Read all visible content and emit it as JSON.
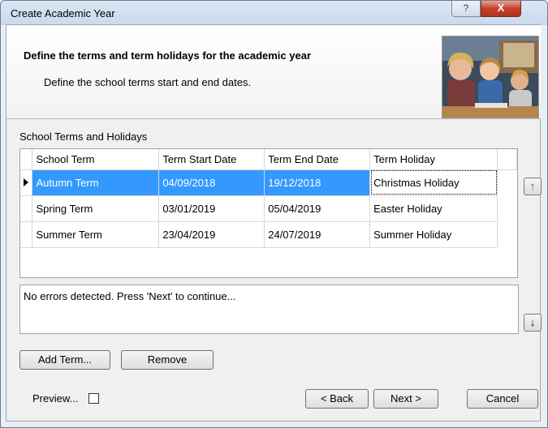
{
  "window": {
    "title": "Create Academic Year",
    "help_symbol": "?",
    "close_symbol": "X"
  },
  "header": {
    "title": "Define the terms and term holidays for the academic year",
    "subtitle": "Define the school terms start and end dates."
  },
  "section": {
    "label": "School Terms and Holidays"
  },
  "grid": {
    "columns": [
      "School Term",
      "Term Start Date",
      "Term End Date",
      "Term Holiday"
    ],
    "rows": [
      {
        "term": "Autumn Term",
        "start": "04/09/2018",
        "end": "19/12/2018",
        "holiday": "Christmas Holiday"
      },
      {
        "term": "Spring Term",
        "start": "03/01/2019",
        "end": "05/04/2019",
        "holiday": "Easter Holiday"
      },
      {
        "term": "Summer Term",
        "start": "23/04/2019",
        "end": "24/07/2019",
        "holiday": "Summer Holiday"
      }
    ]
  },
  "message": "No errors detected. Press 'Next' to continue...",
  "side_buttons": {
    "up_symbol": "↑",
    "down_symbol": "↓"
  },
  "buttons": {
    "add_term": "Add Term...",
    "remove": "Remove",
    "back": "< Back",
    "next": "Next >",
    "cancel": "Cancel"
  },
  "preview": {
    "label": "Preview...",
    "checked": false
  },
  "colors": {
    "selection": "#3399ff",
    "close_button": "#c4412a"
  }
}
